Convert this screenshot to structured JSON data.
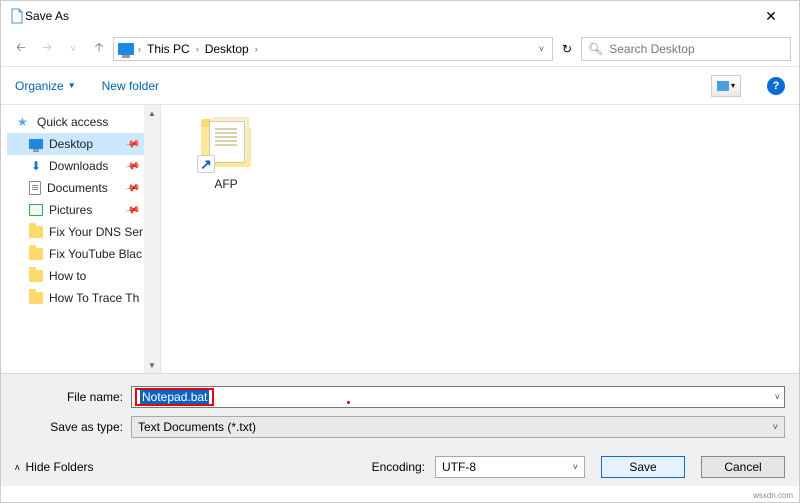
{
  "titlebar": {
    "title": "Save As",
    "close": "✕"
  },
  "nav": {
    "back": "🡠",
    "forward": "🡢",
    "up": "🡡",
    "breadcrumb": [
      "This PC",
      "Desktop"
    ],
    "refresh": "↻",
    "search_placeholder": "Search Desktop"
  },
  "toolbar": {
    "organize": "Organize",
    "newfolder": "New folder",
    "view_drop": "▾",
    "help": "?"
  },
  "tree": {
    "quick_access": "Quick access",
    "items": [
      {
        "label": "Desktop",
        "kind": "desktop",
        "selected": true,
        "pinned": true
      },
      {
        "label": "Downloads",
        "kind": "dl",
        "selected": false,
        "pinned": true
      },
      {
        "label": "Documents",
        "kind": "doc",
        "selected": false,
        "pinned": true
      },
      {
        "label": "Pictures",
        "kind": "pic",
        "selected": false,
        "pinned": true
      },
      {
        "label": "Fix Your DNS Ser",
        "kind": "folder",
        "selected": false,
        "pinned": false
      },
      {
        "label": "Fix YouTube Blac",
        "kind": "folder",
        "selected": false,
        "pinned": false
      },
      {
        "label": "How to",
        "kind": "folder",
        "selected": false,
        "pinned": false
      },
      {
        "label": "How To Trace Th",
        "kind": "folder",
        "selected": false,
        "pinned": false
      }
    ]
  },
  "content": {
    "items": [
      {
        "name": "AFP"
      }
    ]
  },
  "form": {
    "filename_label": "File name:",
    "filename_value": "Notepad.bat",
    "savetype_label": "Save as type:",
    "savetype_value": "Text Documents (*.txt)"
  },
  "footer": {
    "hide_folders": "Hide Folders",
    "encoding_label": "Encoding:",
    "encoding_value": "UTF-8",
    "save": "Save",
    "cancel": "Cancel"
  },
  "watermark": "wsxdn.com"
}
